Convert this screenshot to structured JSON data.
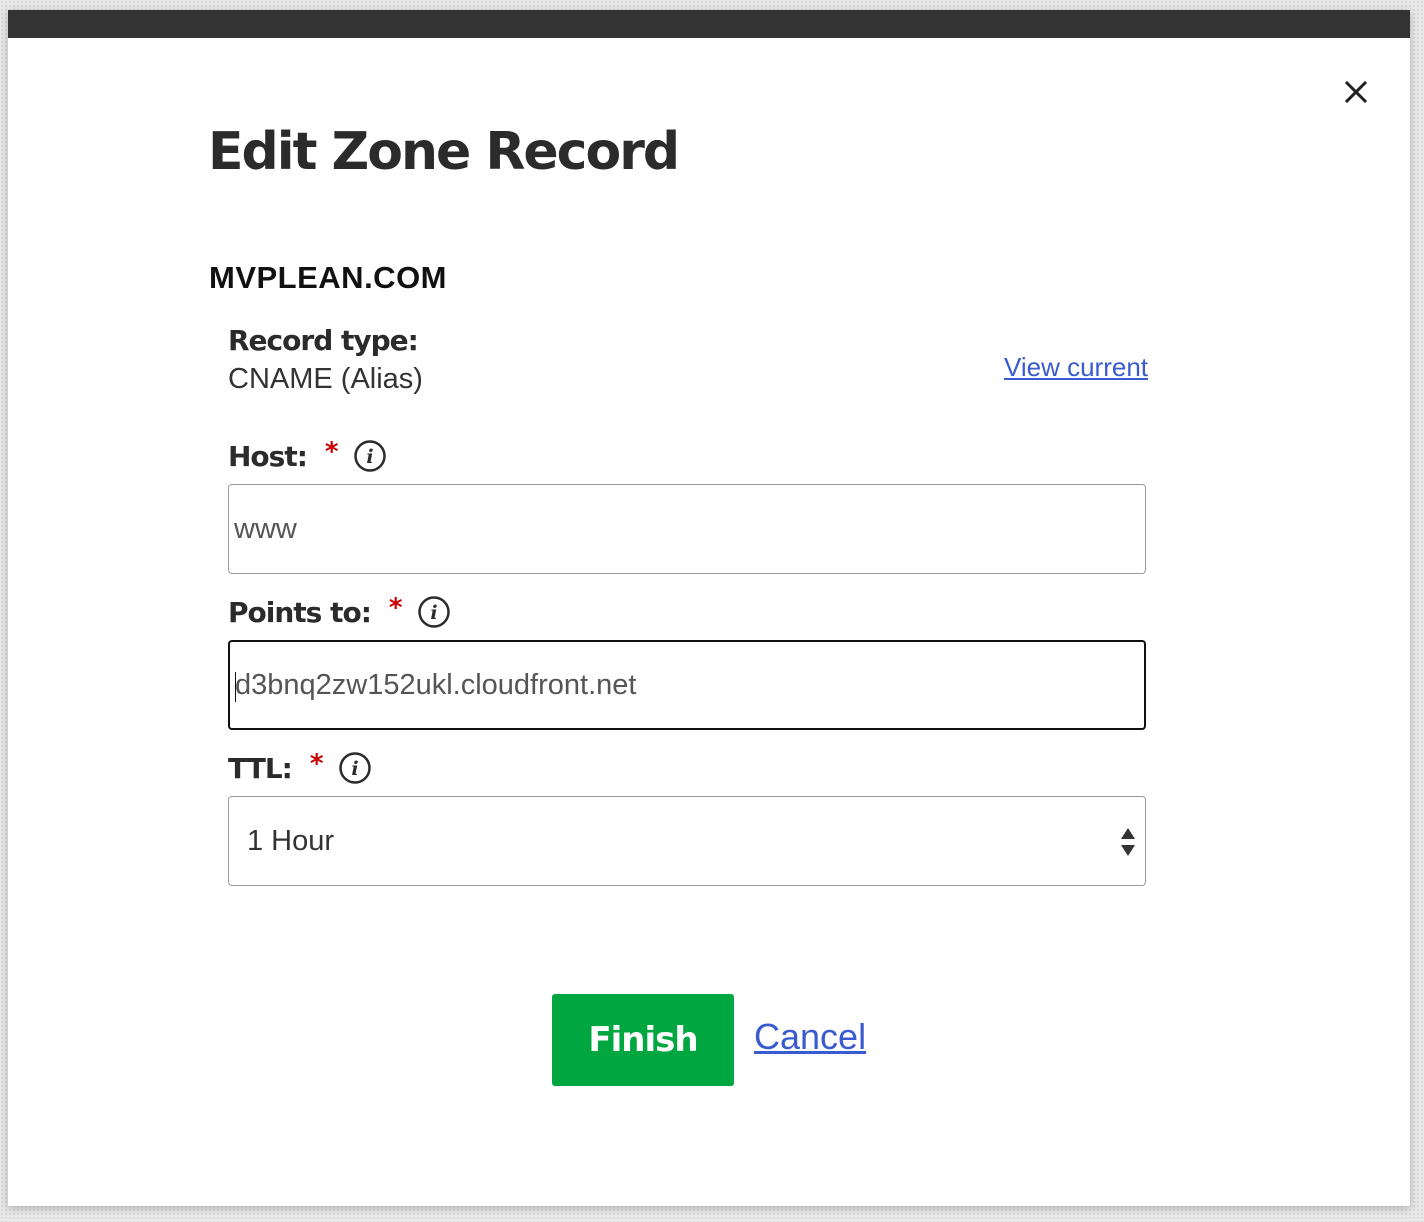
{
  "dialog": {
    "title": "Edit Zone Record",
    "domain": "MVPLEAN.COM",
    "close_icon": "close-icon"
  },
  "record_type": {
    "label": "Record type:",
    "value": "CNAME (Alias)",
    "view_current_link": "View current"
  },
  "host": {
    "label": "Host:",
    "required_mark": "*",
    "value": "www",
    "icon": "info-icon"
  },
  "points_to": {
    "label": "Points to:",
    "required_mark": "*",
    "value": "d3bnq2zw152ukl.cloudfront.net",
    "icon": "info-icon"
  },
  "ttl": {
    "label": "TTL:",
    "required_mark": "*",
    "selected": "1 Hour",
    "icon": "info-icon"
  },
  "actions": {
    "finish_label": "Finish",
    "cancel_label": "Cancel"
  },
  "colors": {
    "finish_button": "#00a63f",
    "link": "#3a5bd0",
    "required": "#cc0000",
    "top_bar": "#333333"
  }
}
